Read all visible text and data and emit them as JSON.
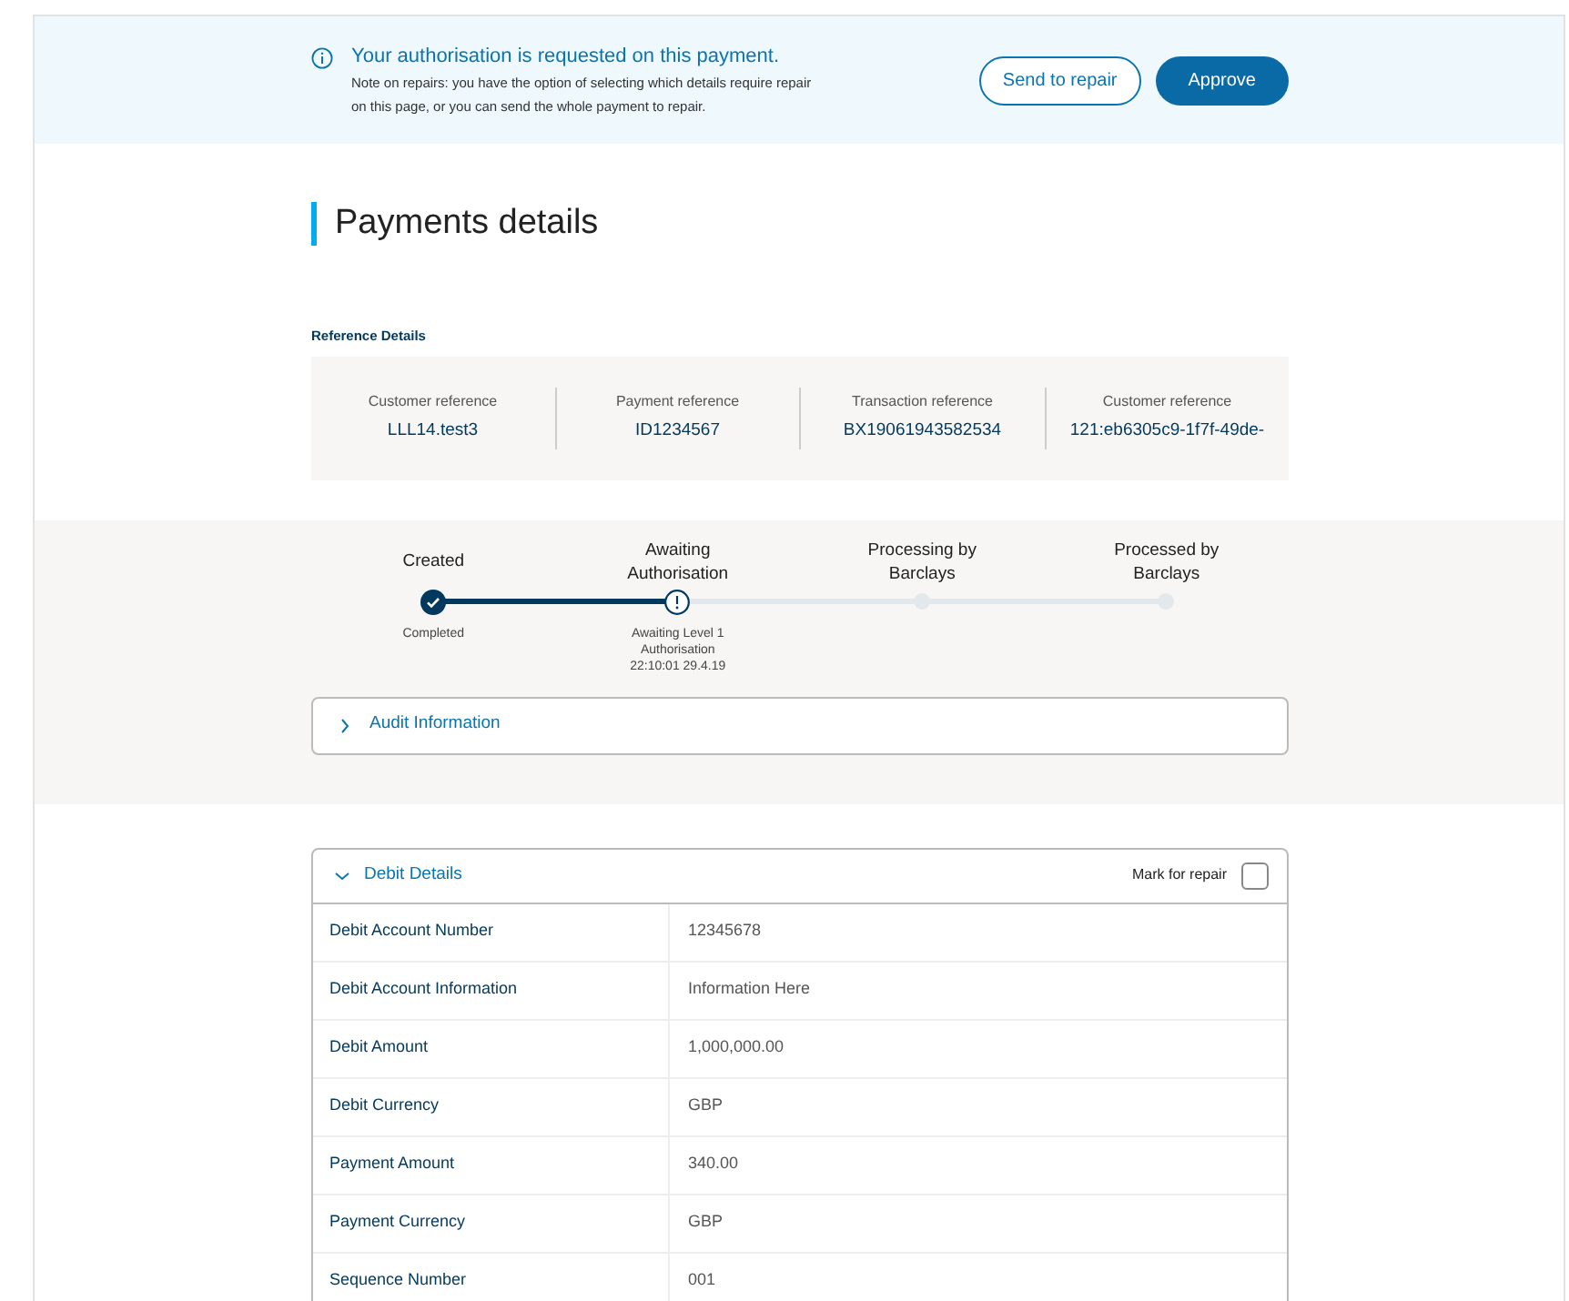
{
  "banner": {
    "title": "Your authorisation is requested on this payment.",
    "note": "Note on repairs: you have the option of selecting which details require repair on this page, or you can send the whole payment to repair.",
    "buttons": [
      {
        "label": "Send to repair",
        "kind": "outline"
      },
      {
        "label": "Approve",
        "kind": "primary"
      }
    ]
  },
  "page_title": "Payments details",
  "reference": {
    "heading": "Reference Details",
    "items": [
      {
        "label": "Customer reference",
        "value": "LLL14.test3"
      },
      {
        "label": "Payment reference",
        "value": "ID1234567"
      },
      {
        "label": "Transaction reference",
        "value": "BX19061943582534"
      },
      {
        "label": "Customer reference",
        "value": "121:eb6305c9-1f7f-49de-"
      }
    ]
  },
  "steps": [
    {
      "label": "Created",
      "kind": "done",
      "note": "Completed"
    },
    {
      "label": "Awaiting Authorisation",
      "kind": "current",
      "note": "Awaiting Level 1 Authorisation 22:10:01 29.4.19"
    },
    {
      "label": "Processing by Barclays",
      "kind": "pending"
    },
    {
      "label": "Processed by Barclays",
      "kind": "pending"
    }
  ],
  "audit": {
    "label": "Audit Information",
    "expanded": false
  },
  "debit": {
    "title": "Debit Details",
    "expanded": true,
    "repair_label": "Mark for repair",
    "repair_checked": false,
    "rows": [
      {
        "label": "Debit Account Number",
        "value": "12345678"
      },
      {
        "label": "Debit Account Information",
        "value": "Information Here"
      },
      {
        "label": "Debit Amount",
        "value": "1,000,000.00"
      },
      {
        "label": "Debit Currency",
        "value": "GBP"
      },
      {
        "label": "Payment Amount",
        "value": "340.00"
      },
      {
        "label": "Payment Currency",
        "value": "GBP"
      },
      {
        "label": "Sequence Number",
        "value": "001"
      }
    ]
  }
}
